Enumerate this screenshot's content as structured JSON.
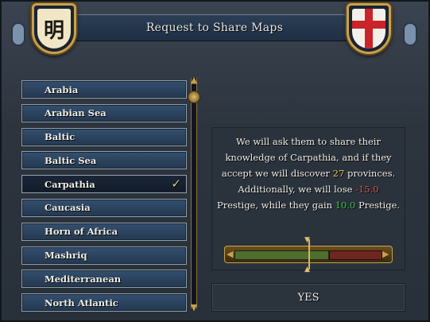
{
  "window": {
    "title": "Request to Share Maps"
  },
  "shields": {
    "left": {
      "glyph": "明",
      "icon": "ming-coat-of-arms-icon"
    },
    "right": {
      "icon": "st-george-cross-coat-of-arms-icon"
    }
  },
  "regions": [
    {
      "label": "Arabia",
      "selected": false
    },
    {
      "label": "Arabian Sea",
      "selected": false
    },
    {
      "label": "Baltic",
      "selected": false
    },
    {
      "label": "Baltic Sea",
      "selected": false
    },
    {
      "label": "Carpathia",
      "selected": true,
      "check": "✓"
    },
    {
      "label": "Caucasia",
      "selected": false
    },
    {
      "label": "Horn of Africa",
      "selected": false
    },
    {
      "label": "Mashriq",
      "selected": false
    },
    {
      "label": "Mediterranean",
      "selected": false
    },
    {
      "label": "North Atlantic",
      "selected": false
    }
  ],
  "info": {
    "part1": "We will ask them to share their knowledge of Carpathia, and if they accept we will discover ",
    "provinces": "27",
    "part2": " provinces. Additionally, we will lose ",
    "prestige_loss": "-15.0",
    "part3": " Prestige, while they gain ",
    "prestige_gain": "10.0",
    "part4": " Prestige."
  },
  "acceptance_bar": {
    "green_fraction": 0.64,
    "marker_fraction": 0.5
  },
  "colors": {
    "gold": "#c8a24a",
    "highlight_yellow": "#e8c650",
    "negative_red": "#e05050",
    "positive_green": "#40c050"
  },
  "buttons": {
    "yes": "YES"
  }
}
